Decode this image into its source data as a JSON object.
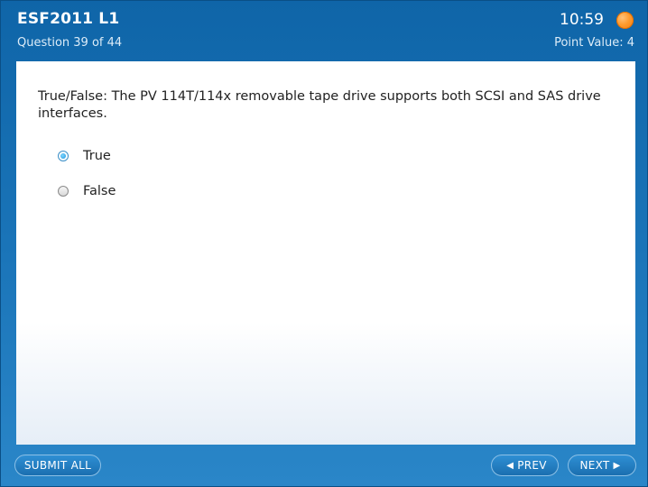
{
  "header": {
    "title": "ESF2011  L1",
    "question_counter": "Question 39 of 44",
    "timer": "10:59",
    "point_value": "Point Value:  4",
    "timer_icon": "clock-orange-icon",
    "timer_icon_color": "#ff9b2e"
  },
  "question": {
    "text": "True/False:  The PV 114T/114x removable tape drive supports both SCSI and SAS drive interfaces.",
    "options": [
      {
        "label": "True",
        "selected": true
      },
      {
        "label": "False",
        "selected": false
      }
    ]
  },
  "footer": {
    "submit_label": "SUBMIT ALL",
    "prev_label": "PREV",
    "next_label": "NEXT",
    "prev_icon": "prev-arrow-icon",
    "next_icon": "next-arrow-icon"
  },
  "colors": {
    "frame_blue": "#1a74b8",
    "accent_light_blue": "#1e95dd"
  }
}
